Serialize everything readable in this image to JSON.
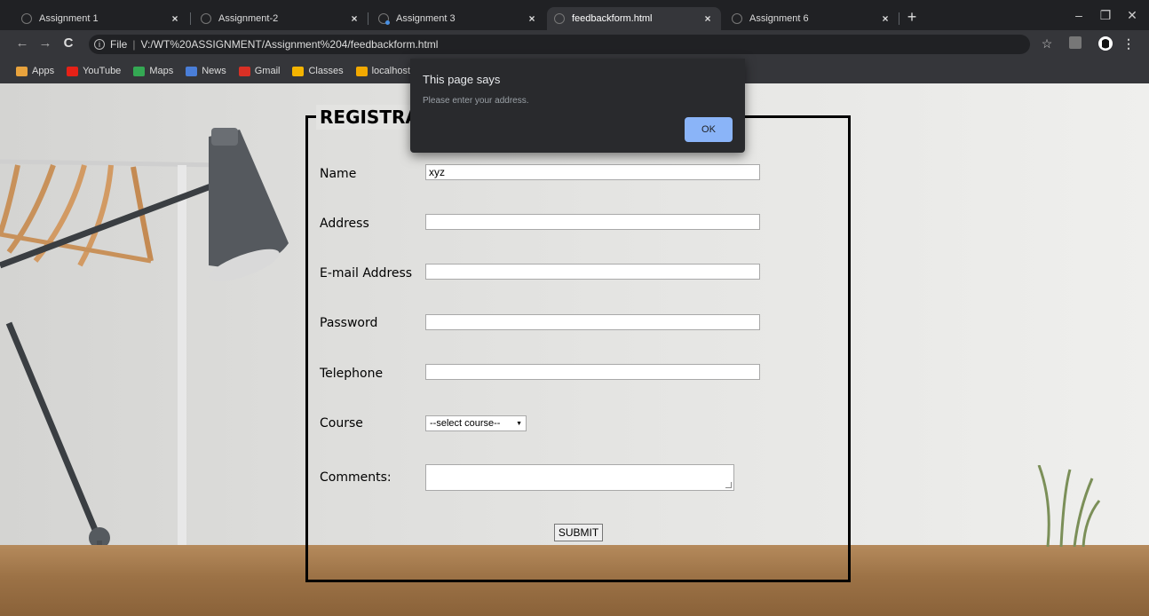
{
  "tabs": [
    {
      "title": "Assignment 1",
      "active": false
    },
    {
      "title": "Assignment-2",
      "active": false
    },
    {
      "title": "Assignment 3",
      "active": false
    },
    {
      "title": "feedbackform.html",
      "active": true
    },
    {
      "title": "Assignment 6",
      "active": false
    }
  ],
  "tab_close": "×",
  "new_tab": "+",
  "window": {
    "minimize": "–",
    "restore": "❐",
    "close": "✕"
  },
  "nav": {
    "back": "←",
    "forward": "→",
    "reload": "C"
  },
  "omnibox": {
    "info": "i",
    "scheme_label": "File",
    "separator": "|",
    "url": "V:/WT%20ASSIGNMENT/Assignment%204/feedbackform.html"
  },
  "toolbar_right": {
    "star": "☆",
    "menu": "⋮"
  },
  "bookmarks": [
    {
      "label": "Apps",
      "color": "#e8a33d"
    },
    {
      "label": "YouTube",
      "color": "#e62117"
    },
    {
      "label": "Maps",
      "color": "#34a853"
    },
    {
      "label": "News",
      "color": "#4a7ed8"
    },
    {
      "label": "Gmail",
      "color": "#d93025"
    },
    {
      "label": "Classes",
      "color": "#f4b400"
    },
    {
      "label": "localhost / 1",
      "color": "#f2a900"
    }
  ],
  "form": {
    "legend": "REGISTRA",
    "fields": [
      {
        "label": "Name",
        "value": "xyz"
      },
      {
        "label": "Address",
        "value": ""
      },
      {
        "label": "E-mail Address",
        "value": ""
      },
      {
        "label": "Password",
        "value": ""
      },
      {
        "label": "Telephone",
        "value": ""
      }
    ],
    "course_label": "Course",
    "course_selected": "--select course--",
    "select_arrow": "▼",
    "comments_label": "Comments:",
    "submit_label": "SUBMIT"
  },
  "dialog": {
    "title": "This page says",
    "message": "Please enter your address.",
    "ok_label": "OK"
  }
}
